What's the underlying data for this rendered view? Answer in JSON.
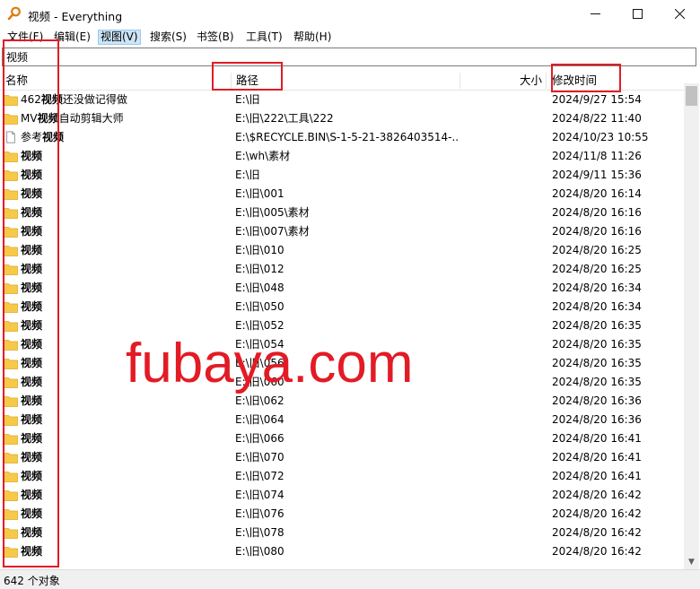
{
  "window": {
    "title": "视频 - Everything",
    "minimize_icon": "minimize-icon",
    "maximize_icon": "maximize-icon",
    "close_icon": "close-icon"
  },
  "menu": [
    "文件(F)",
    "编辑(E)",
    "视图(V)",
    "搜索(S)",
    "书签(B)",
    "工具(T)",
    "帮助(H)"
  ],
  "search": {
    "value": "视频"
  },
  "columns": {
    "name": "名称",
    "path": "路径",
    "size": "大小",
    "modified": "修改时间"
  },
  "rows": [
    {
      "name_prefix": "462",
      "name_bold": "视频",
      "name_suffix": "还没做记得做",
      "path": "E:\\旧",
      "modified": "2024/9/27 15:54",
      "icon": "folder-icon"
    },
    {
      "name_prefix": "MV",
      "name_bold": "视频",
      "name_suffix": "自动剪辑大师",
      "path": "E:\\旧\\222\\工具\\222",
      "modified": "2024/8/22 11:40",
      "icon": "folder-icon"
    },
    {
      "name_prefix": "参考",
      "name_bold": "视频",
      "name_suffix": "",
      "path": "E:\\$RECYCLE.BIN\\S-1-5-21-3826403514-...",
      "modified": "2024/10/23 10:55",
      "icon": "file-icon"
    },
    {
      "name_prefix": "",
      "name_bold": "视频",
      "name_suffix": "",
      "path": "E:\\wh\\素材",
      "modified": "2024/11/8 11:26",
      "icon": "folder-icon"
    },
    {
      "name_prefix": "",
      "name_bold": "视频",
      "name_suffix": "",
      "path": "E:\\旧",
      "modified": "2024/9/11 15:36",
      "icon": "folder-icon"
    },
    {
      "name_prefix": "",
      "name_bold": "视频",
      "name_suffix": "",
      "path": "E:\\旧\\001",
      "modified": "2024/8/20 16:14",
      "icon": "folder-icon"
    },
    {
      "name_prefix": "",
      "name_bold": "视频",
      "name_suffix": "",
      "path": "E:\\旧\\005\\素材",
      "modified": "2024/8/20 16:16",
      "icon": "folder-icon"
    },
    {
      "name_prefix": "",
      "name_bold": "视频",
      "name_suffix": "",
      "path": "E:\\旧\\007\\素材",
      "modified": "2024/8/20 16:16",
      "icon": "folder-icon"
    },
    {
      "name_prefix": "",
      "name_bold": "视频",
      "name_suffix": "",
      "path": "E:\\旧\\010",
      "modified": "2024/8/20 16:25",
      "icon": "folder-icon"
    },
    {
      "name_prefix": "",
      "name_bold": "视频",
      "name_suffix": "",
      "path": "E:\\旧\\012",
      "modified": "2024/8/20 16:25",
      "icon": "folder-icon"
    },
    {
      "name_prefix": "",
      "name_bold": "视频",
      "name_suffix": "",
      "path": "E:\\旧\\048",
      "modified": "2024/8/20 16:34",
      "icon": "folder-icon"
    },
    {
      "name_prefix": "",
      "name_bold": "视频",
      "name_suffix": "",
      "path": "E:\\旧\\050",
      "modified": "2024/8/20 16:34",
      "icon": "folder-icon"
    },
    {
      "name_prefix": "",
      "name_bold": "视频",
      "name_suffix": "",
      "path": "E:\\旧\\052",
      "modified": "2024/8/20 16:35",
      "icon": "folder-icon"
    },
    {
      "name_prefix": "",
      "name_bold": "视频",
      "name_suffix": "",
      "path": "E:\\旧\\054",
      "modified": "2024/8/20 16:35",
      "icon": "folder-icon"
    },
    {
      "name_prefix": "",
      "name_bold": "视频",
      "name_suffix": "",
      "path": "E:\\旧\\056",
      "modified": "2024/8/20 16:35",
      "icon": "folder-icon"
    },
    {
      "name_prefix": "",
      "name_bold": "视频",
      "name_suffix": "",
      "path": "E:\\旧\\060",
      "modified": "2024/8/20 16:35",
      "icon": "folder-icon"
    },
    {
      "name_prefix": "",
      "name_bold": "视频",
      "name_suffix": "",
      "path": "E:\\旧\\062",
      "modified": "2024/8/20 16:36",
      "icon": "folder-icon"
    },
    {
      "name_prefix": "",
      "name_bold": "视频",
      "name_suffix": "",
      "path": "E:\\旧\\064",
      "modified": "2024/8/20 16:36",
      "icon": "folder-icon"
    },
    {
      "name_prefix": "",
      "name_bold": "视频",
      "name_suffix": "",
      "path": "E:\\旧\\066",
      "modified": "2024/8/20 16:41",
      "icon": "folder-icon"
    },
    {
      "name_prefix": "",
      "name_bold": "视频",
      "name_suffix": "",
      "path": "E:\\旧\\070",
      "modified": "2024/8/20 16:41",
      "icon": "folder-icon"
    },
    {
      "name_prefix": "",
      "name_bold": "视频",
      "name_suffix": "",
      "path": "E:\\旧\\072",
      "modified": "2024/8/20 16:41",
      "icon": "folder-icon"
    },
    {
      "name_prefix": "",
      "name_bold": "视频",
      "name_suffix": "",
      "path": "E:\\旧\\074",
      "modified": "2024/8/20 16:42",
      "icon": "folder-icon"
    },
    {
      "name_prefix": "",
      "name_bold": "视频",
      "name_suffix": "",
      "path": "E:\\旧\\076",
      "modified": "2024/8/20 16:42",
      "icon": "folder-icon"
    },
    {
      "name_prefix": "",
      "name_bold": "视频",
      "name_suffix": "",
      "path": "E:\\旧\\078",
      "modified": "2024/8/20 16:42",
      "icon": "folder-icon"
    },
    {
      "name_prefix": "",
      "name_bold": "视频",
      "name_suffix": "",
      "path": "E:\\旧\\080",
      "modified": "2024/8/20 16:42",
      "icon": "folder-icon"
    }
  ],
  "status": {
    "count": "642 个对象"
  },
  "watermark": "fubaya.com",
  "colors": {
    "folder": "#f7c948",
    "folder_dark": "#e0a82e",
    "annotation_red": "#e21b25",
    "menu_active": "#cce4f7"
  }
}
